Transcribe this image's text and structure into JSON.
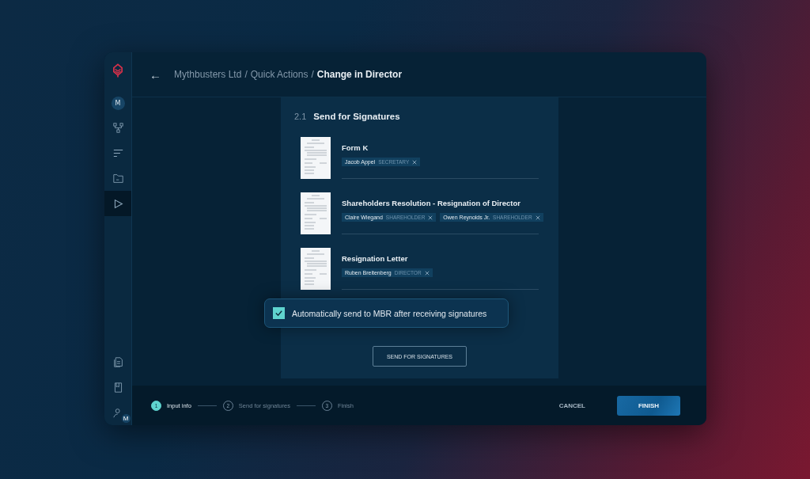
{
  "sidebar": {
    "avatar": "M",
    "items": [
      {
        "selected": false
      },
      {
        "selected": false
      },
      {
        "selected": false
      },
      {
        "selected": true
      }
    ],
    "user_badge": "M"
  },
  "breadcrumb": {
    "back": "←",
    "path": [
      "Mythbusters Ltd",
      "Quick Actions"
    ],
    "current": "Change in Director",
    "separator": "/"
  },
  "section": {
    "number": "2.1",
    "title": "Send for Signatures"
  },
  "documents": [
    {
      "title": "Form K",
      "signers": [
        {
          "name": "Jacob Appel",
          "role": "SECRETARY"
        }
      ]
    },
    {
      "title": "Shareholders Resolution - Resignation of Director",
      "signers": [
        {
          "name": "Claire Wiegand",
          "role": "SHAREHOLDER"
        },
        {
          "name": "Owen Reynolds Jr.",
          "role": "SHAREHOLDER"
        }
      ]
    },
    {
      "title": "Resignation Letter",
      "signers": [
        {
          "name": "Ruben Breitenberg",
          "role": "DIRECTOR"
        }
      ]
    }
  ],
  "auto_send": {
    "label": "Automatically send to MBR after receiving signatures",
    "checked": true
  },
  "send_button": "SEND FOR SIGNATURES",
  "steps": [
    {
      "number": "1",
      "label": "Input info",
      "selected": true
    },
    {
      "number": "2",
      "label": "Send for signatures",
      "selected": false
    },
    {
      "number": "3",
      "label": "Finish",
      "selected": false
    }
  ],
  "cancel_button": "CANCEL",
  "finish_button": "FINISH"
}
